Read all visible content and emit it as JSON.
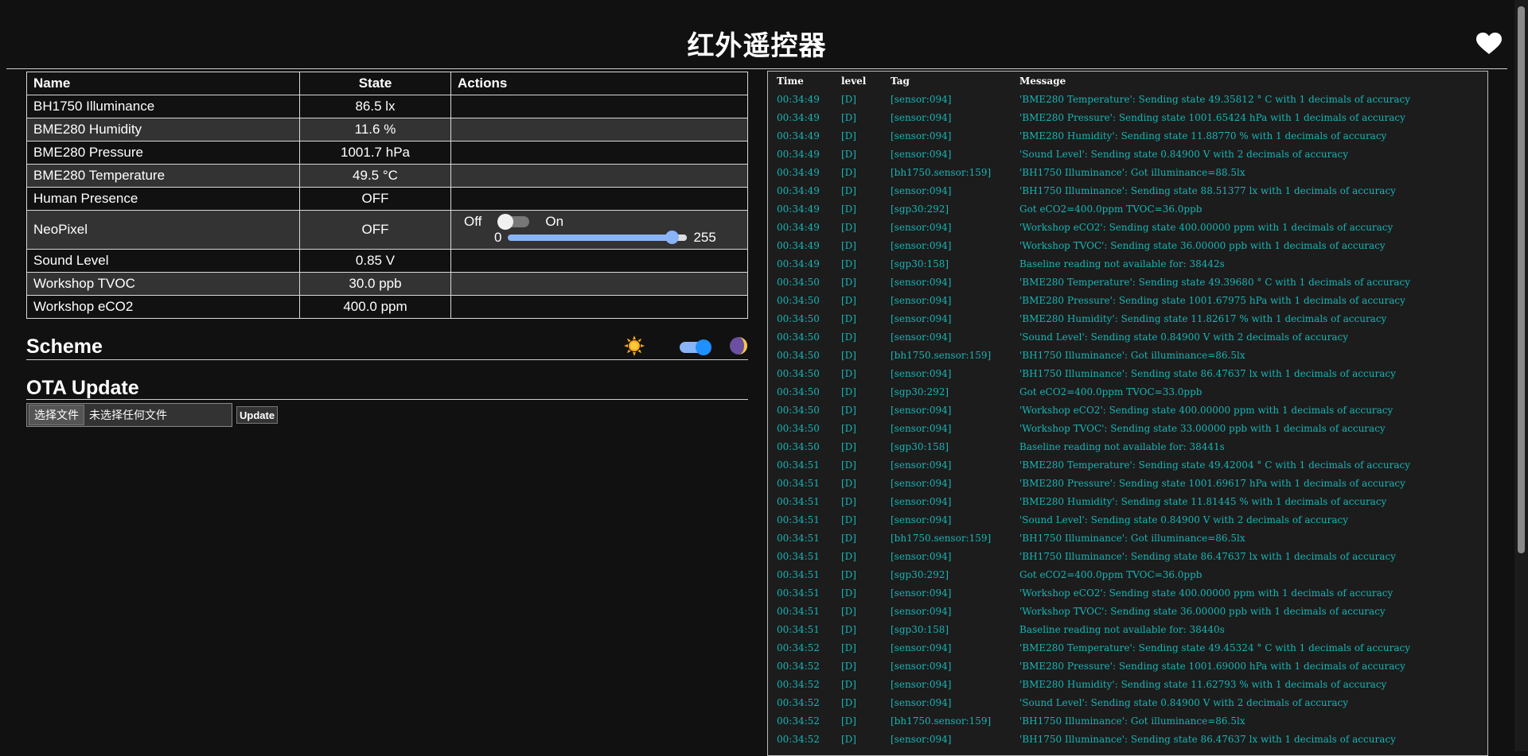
{
  "header": {
    "title": "红外遥控器"
  },
  "table": {
    "headers": {
      "name": "Name",
      "state": "State",
      "actions": "Actions"
    },
    "rows": [
      {
        "name": "BH1750 Illuminance",
        "state": "86.5 lx"
      },
      {
        "name": "BME280 Humidity",
        "state": "11.6 %"
      },
      {
        "name": "BME280 Pressure",
        "state": "1001.7 hPa"
      },
      {
        "name": "BME280 Temperature",
        "state": "49.5 °C"
      },
      {
        "name": "Human Presence",
        "state": "OFF"
      },
      {
        "name": "NeoPixel",
        "state": "OFF"
      },
      {
        "name": "Sound Level",
        "state": "0.85 V"
      },
      {
        "name": "Workshop TVOC",
        "state": "30.0 ppb"
      },
      {
        "name": "Workshop eCO2",
        "state": "400.0 ppm"
      }
    ]
  },
  "neopixel": {
    "off_label": "Off",
    "on_label": "On",
    "min": "0",
    "max": "255",
    "value": 255
  },
  "scheme": {
    "title": "Scheme",
    "dark": true
  },
  "ota": {
    "title": "OTA Update",
    "choose_label": "选择文件",
    "no_file_label": "未选择任何文件",
    "update_label": "Update"
  },
  "log": {
    "headers": {
      "time": "Time",
      "level": "level",
      "tag": "Tag",
      "message": "Message"
    },
    "rows": [
      {
        "time": "00:34:49",
        "level": "[D]",
        "tag": "[sensor:094]",
        "msg": "'BME280 Temperature': Sending state 49.35812 ° C with 1 decimals of accuracy"
      },
      {
        "time": "00:34:49",
        "level": "[D]",
        "tag": "[sensor:094]",
        "msg": "'BME280 Pressure': Sending state 1001.65424 hPa with 1 decimals of accuracy"
      },
      {
        "time": "00:34:49",
        "level": "[D]",
        "tag": "[sensor:094]",
        "msg": "'BME280 Humidity': Sending state 11.88770 % with 1 decimals of accuracy"
      },
      {
        "time": "00:34:49",
        "level": "[D]",
        "tag": "[sensor:094]",
        "msg": "'Sound Level': Sending state 0.84900 V with 2 decimals of accuracy"
      },
      {
        "time": "00:34:49",
        "level": "[D]",
        "tag": "[bh1750.sensor:159]",
        "msg": "'BH1750 Illuminance': Got illuminance=88.5lx"
      },
      {
        "time": "00:34:49",
        "level": "[D]",
        "tag": "[sensor:094]",
        "msg": "'BH1750 Illuminance': Sending state 88.51377 lx with 1 decimals of accuracy"
      },
      {
        "time": "00:34:49",
        "level": "[D]",
        "tag": "[sgp30:292]",
        "msg": "Got eCO2=400.0ppm TVOC=36.0ppb"
      },
      {
        "time": "00:34:49",
        "level": "[D]",
        "tag": "[sensor:094]",
        "msg": "'Workshop eCO2': Sending state 400.00000 ppm with 1 decimals of accuracy"
      },
      {
        "time": "00:34:49",
        "level": "[D]",
        "tag": "[sensor:094]",
        "msg": "'Workshop TVOC': Sending state 36.00000 ppb with 1 decimals of accuracy"
      },
      {
        "time": "00:34:49",
        "level": "[D]",
        "tag": "[sgp30:158]",
        "msg": "Baseline reading not available for: 38442s"
      },
      {
        "time": "00:34:50",
        "level": "[D]",
        "tag": "[sensor:094]",
        "msg": "'BME280 Temperature': Sending state 49.39680 ° C with 1 decimals of accuracy"
      },
      {
        "time": "00:34:50",
        "level": "[D]",
        "tag": "[sensor:094]",
        "msg": "'BME280 Pressure': Sending state 1001.67975 hPa with 1 decimals of accuracy"
      },
      {
        "time": "00:34:50",
        "level": "[D]",
        "tag": "[sensor:094]",
        "msg": "'BME280 Humidity': Sending state 11.82617 % with 1 decimals of accuracy"
      },
      {
        "time": "00:34:50",
        "level": "[D]",
        "tag": "[sensor:094]",
        "msg": "'Sound Level': Sending state 0.84900 V with 2 decimals of accuracy"
      },
      {
        "time": "00:34:50",
        "level": "[D]",
        "tag": "[bh1750.sensor:159]",
        "msg": "'BH1750 Illuminance': Got illuminance=86.5lx"
      },
      {
        "time": "00:34:50",
        "level": "[D]",
        "tag": "[sensor:094]",
        "msg": "'BH1750 Illuminance': Sending state 86.47637 lx with 1 decimals of accuracy"
      },
      {
        "time": "00:34:50",
        "level": "[D]",
        "tag": "[sgp30:292]",
        "msg": "Got eCO2=400.0ppm TVOC=33.0ppb"
      },
      {
        "time": "00:34:50",
        "level": "[D]",
        "tag": "[sensor:094]",
        "msg": "'Workshop eCO2': Sending state 400.00000 ppm with 1 decimals of accuracy"
      },
      {
        "time": "00:34:50",
        "level": "[D]",
        "tag": "[sensor:094]",
        "msg": "'Workshop TVOC': Sending state 33.00000 ppb with 1 decimals of accuracy"
      },
      {
        "time": "00:34:50",
        "level": "[D]",
        "tag": "[sgp30:158]",
        "msg": "Baseline reading not available for: 38441s"
      },
      {
        "time": "00:34:51",
        "level": "[D]",
        "tag": "[sensor:094]",
        "msg": "'BME280 Temperature': Sending state 49.42004 ° C with 1 decimals of accuracy"
      },
      {
        "time": "00:34:51",
        "level": "[D]",
        "tag": "[sensor:094]",
        "msg": "'BME280 Pressure': Sending state 1001.69617 hPa with 1 decimals of accuracy"
      },
      {
        "time": "00:34:51",
        "level": "[D]",
        "tag": "[sensor:094]",
        "msg": "'BME280 Humidity': Sending state 11.81445 % with 1 decimals of accuracy"
      },
      {
        "time": "00:34:51",
        "level": "[D]",
        "tag": "[sensor:094]",
        "msg": "'Sound Level': Sending state 0.84900 V with 2 decimals of accuracy"
      },
      {
        "time": "00:34:51",
        "level": "[D]",
        "tag": "[bh1750.sensor:159]",
        "msg": "'BH1750 Illuminance': Got illuminance=86.5lx"
      },
      {
        "time": "00:34:51",
        "level": "[D]",
        "tag": "[sensor:094]",
        "msg": "'BH1750 Illuminance': Sending state 86.47637 lx with 1 decimals of accuracy"
      },
      {
        "time": "00:34:51",
        "level": "[D]",
        "tag": "[sgp30:292]",
        "msg": "Got eCO2=400.0ppm TVOC=36.0ppb"
      },
      {
        "time": "00:34:51",
        "level": "[D]",
        "tag": "[sensor:094]",
        "msg": "'Workshop eCO2': Sending state 400.00000 ppm with 1 decimals of accuracy"
      },
      {
        "time": "00:34:51",
        "level": "[D]",
        "tag": "[sensor:094]",
        "msg": "'Workshop TVOC': Sending state 36.00000 ppb with 1 decimals of accuracy"
      },
      {
        "time": "00:34:51",
        "level": "[D]",
        "tag": "[sgp30:158]",
        "msg": "Baseline reading not available for: 38440s"
      },
      {
        "time": "00:34:52",
        "level": "[D]",
        "tag": "[sensor:094]",
        "msg": "'BME280 Temperature': Sending state 49.45324 ° C with 1 decimals of accuracy"
      },
      {
        "time": "00:34:52",
        "level": "[D]",
        "tag": "[sensor:094]",
        "msg": "'BME280 Pressure': Sending state 1001.69000 hPa with 1 decimals of accuracy"
      },
      {
        "time": "00:34:52",
        "level": "[D]",
        "tag": "[sensor:094]",
        "msg": "'BME280 Humidity': Sending state 11.62793 % with 1 decimals of accuracy"
      },
      {
        "time": "00:34:52",
        "level": "[D]",
        "tag": "[sensor:094]",
        "msg": "'Sound Level': Sending state 0.84900 V with 2 decimals of accuracy"
      },
      {
        "time": "00:34:52",
        "level": "[D]",
        "tag": "[bh1750.sensor:159]",
        "msg": "'BH1750 Illuminance': Got illuminance=86.5lx"
      },
      {
        "time": "00:34:52",
        "level": "[D]",
        "tag": "[sensor:094]",
        "msg": "'BH1750 Illuminance': Sending state 86.47637 lx with 1 decimals of accuracy"
      }
    ]
  },
  "colors": {
    "background": "#111111",
    "row_alt": "#333333",
    "log_text": "#19b4b4",
    "accent": "#8ab4f8"
  },
  "icons": {
    "heart": "heart-icon",
    "sun": "sun-icon",
    "moon": "moon-icon"
  }
}
